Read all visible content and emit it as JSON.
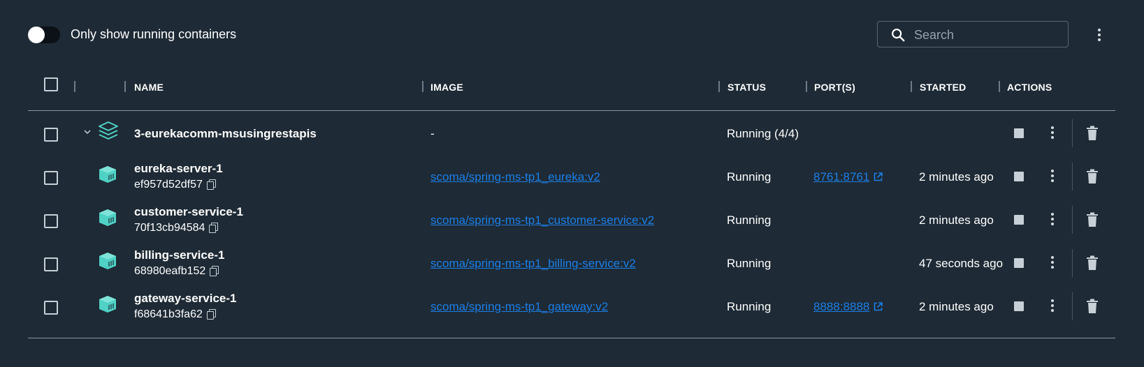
{
  "toolbar": {
    "toggle_label": "Only show running containers",
    "toggle_on": false,
    "search_placeholder": "Search"
  },
  "columns": {
    "name": "NAME",
    "image": "IMAGE",
    "status": "STATUS",
    "ports": "PORT(S)",
    "started": "STARTED",
    "actions": "ACTIONS"
  },
  "group": {
    "name": "3-eurekacomm-msusingrestapis",
    "image": "-",
    "status": "Running (4/4)",
    "icon": "layers-stack-icon"
  },
  "containers": [
    {
      "name": "eureka-server-1",
      "id": "ef957d52df57",
      "image": "scoma/spring-ms-tp1_eureka:v2",
      "status": "Running",
      "port": "8761:8761",
      "started": "2 minutes ago"
    },
    {
      "name": "customer-service-1",
      "id": "70f13cb94584",
      "image": "scoma/spring-ms-tp1_customer-service:v2",
      "status": "Running",
      "port": "",
      "started": "2 minutes ago"
    },
    {
      "name": "billing-service-1",
      "id": "68980eafb152",
      "image": "scoma/spring-ms-tp1_billing-service:v2",
      "status": "Running",
      "port": "",
      "started": "47 seconds ago"
    },
    {
      "name": "gateway-service-1",
      "id": "f68641b3fa62",
      "image": "scoma/spring-ms-tp1_gateway:v2",
      "status": "Running",
      "port": "8888:8888",
      "started": "2 minutes ago"
    }
  ],
  "colors": {
    "background": "#1e2a35",
    "link": "#1b7fe8",
    "container_icon": "#4fd1c5"
  }
}
